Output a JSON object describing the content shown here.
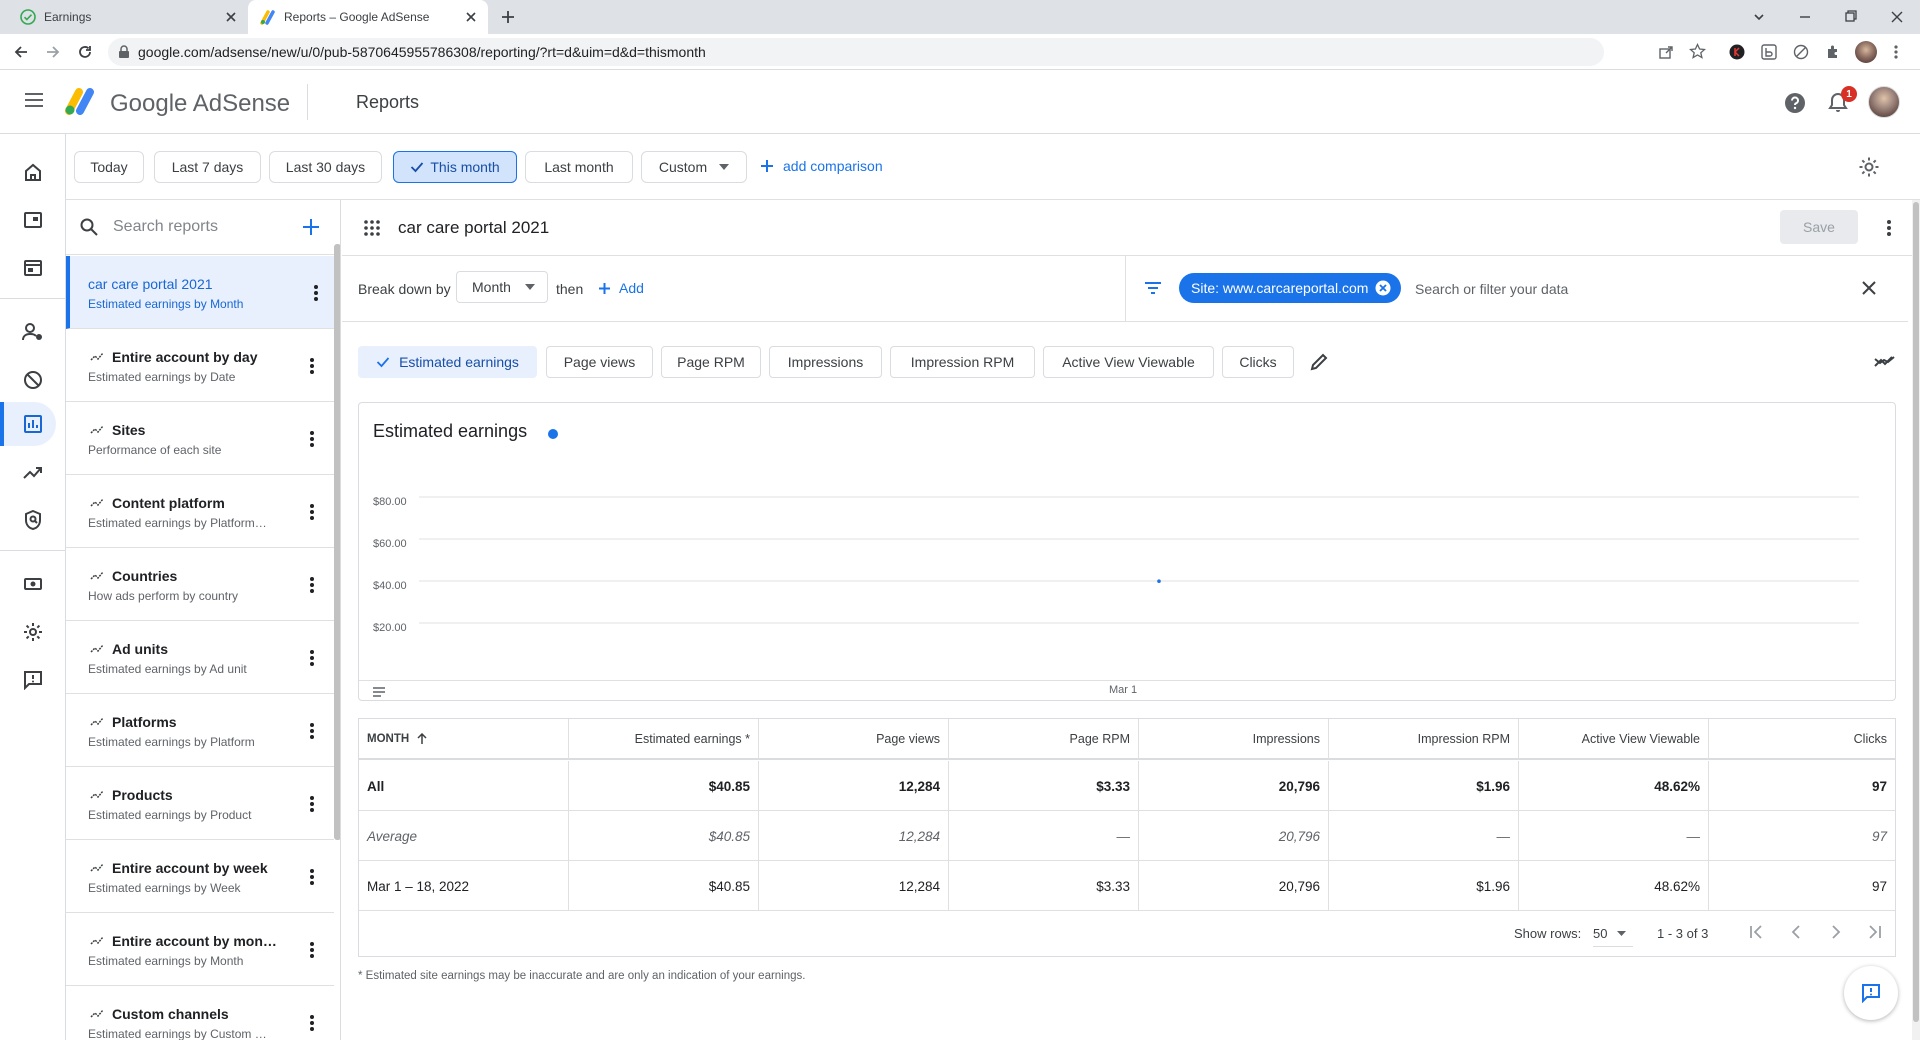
{
  "browser": {
    "tabs": [
      {
        "title": "Earnings"
      },
      {
        "title": "Reports – Google AdSense"
      }
    ],
    "url": "google.com/adsense/new/u/0/pub-5870645955786308/reporting/?rt=d&uim=d&d=thismonth",
    "notification_count": "1"
  },
  "header": {
    "brand": "Google AdSense",
    "page_title": "Reports"
  },
  "date_range": {
    "options": [
      "Today",
      "Last 7 days",
      "Last 30 days",
      "This month",
      "Last month",
      "Custom"
    ],
    "selected": "This month",
    "add_comparison": "add comparison"
  },
  "report_list": {
    "search_placeholder": "Search reports",
    "items": [
      {
        "title": "car care portal 2021",
        "subtitle": "Estimated earnings by Month",
        "active": true
      },
      {
        "title": "Entire account by day",
        "subtitle": "Estimated earnings by Date"
      },
      {
        "title": "Sites",
        "subtitle": "Performance of each site"
      },
      {
        "title": "Content platform",
        "subtitle": "Estimated earnings by Platform…"
      },
      {
        "title": "Countries",
        "subtitle": "How ads perform by country"
      },
      {
        "title": "Ad units",
        "subtitle": "Estimated earnings by Ad unit"
      },
      {
        "title": "Platforms",
        "subtitle": "Estimated earnings by Platform"
      },
      {
        "title": "Products",
        "subtitle": "Estimated earnings by Product"
      },
      {
        "title": "Entire account by week",
        "subtitle": "Estimated earnings by Week"
      },
      {
        "title": "Entire account by mon…",
        "subtitle": "Estimated earnings by Month"
      },
      {
        "title": "Custom channels",
        "subtitle": "Estimated earnings by Custom …"
      }
    ]
  },
  "report": {
    "name": "car care portal 2021",
    "save_label": "Save",
    "breakdown_label": "Break down by",
    "breakdown_value": "Month",
    "then_label": "then",
    "add_label": "Add",
    "filter_chip": "Site: www.carcareportal.com",
    "filter_placeholder": "Search or filter your data",
    "metrics": [
      {
        "label": "Estimated earnings",
        "selected": true
      },
      {
        "label": "Page views"
      },
      {
        "label": "Page RPM"
      },
      {
        "label": "Impressions"
      },
      {
        "label": "Impression RPM"
      },
      {
        "label": "Active View Viewable"
      },
      {
        "label": "Clicks"
      }
    ]
  },
  "chart_data": {
    "type": "scatter",
    "title": "Estimated earnings",
    "series_color": "#1a73e8",
    "y_ticks": [
      "$80.00",
      "$60.00",
      "$40.00",
      "$20.00"
    ],
    "ylim": [
      0,
      100
    ],
    "x_ticks": [
      "Mar 1"
    ],
    "points": [
      {
        "x": "Mar 1",
        "y": 40.85
      }
    ],
    "grid": true
  },
  "table": {
    "headers": [
      "MONTH",
      "Estimated earnings *",
      "Page views",
      "Page RPM",
      "Impressions",
      "Impression RPM",
      "Active View Viewable",
      "Clicks"
    ],
    "rows": [
      {
        "cells": [
          "All",
          "$40.85",
          "12,284",
          "$3.33",
          "20,796",
          "$1.96",
          "48.62%",
          "97"
        ],
        "style": "bold"
      },
      {
        "cells": [
          "Average",
          "$40.85",
          "12,284",
          "—",
          "20,796",
          "—",
          "—",
          "97"
        ],
        "style": "italic"
      },
      {
        "cells": [
          "Mar 1 – 18, 2022",
          "$40.85",
          "12,284",
          "$3.33",
          "20,796",
          "$1.96",
          "48.62%",
          "97"
        ],
        "style": "normal"
      }
    ],
    "show_rows_label": "Show rows:",
    "rows_per_page": "50",
    "pagination_text": "1 - 3 of 3"
  },
  "footnote": "* Estimated site earnings may be inaccurate and are only an indication of your earnings.",
  "colors": {
    "accent": "#1a73e8",
    "selected_bg": "#d2e3fc"
  }
}
